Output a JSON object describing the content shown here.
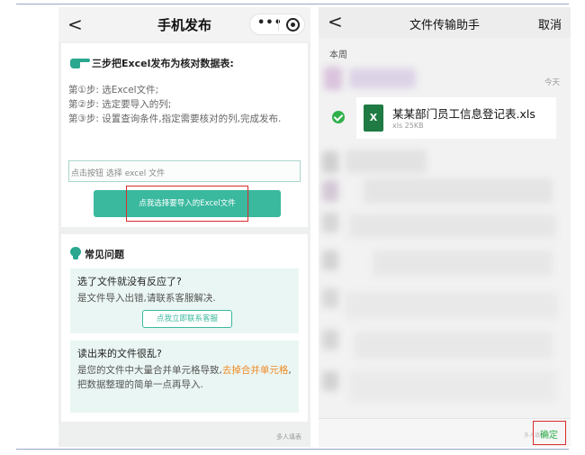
{
  "left": {
    "nav": {
      "back": "<",
      "title": "手机发布",
      "capsule_dots": "•••"
    },
    "card1": {
      "heading": "三步把Excel发布为核对数据表:",
      "steps": [
        "第①步: 选Excel文件;",
        "第②步: 选定要导入的列;",
        "第③步: 设置查询条件,指定需要核对的列,完成发布."
      ],
      "file_input_placeholder": "点击按钮 选择 excel 文件",
      "primary_button": "点我选择要导入的Excel文件"
    },
    "faq": {
      "title": "常见问题",
      "items": [
        {
          "q": "选了文件就没有反应了?",
          "a": "是文件导入出错,请联系客服解决.",
          "button": "点我立即联系客服"
        },
        {
          "q": "读出来的文件很乱?",
          "a_pre": "是您的文件中大量合并单元格导致,",
          "a_highlight": "去掉合并单元格",
          "a_post": ",把数据整理的简单一点再导入."
        }
      ]
    },
    "watermark": "多人填表"
  },
  "right": {
    "nav": {
      "back": "<",
      "title": "文件传输助手",
      "cancel": "取消"
    },
    "section_label": "本周",
    "today": "今天",
    "file": {
      "icon_letter": "X",
      "name": "某某部门员工信息登记表.xls",
      "meta": "xls 25KB"
    },
    "confirm": "确定",
    "watermark": "多人填表"
  },
  "colors": {
    "accent_teal": "#3ab99f",
    "highlight_red": "#d92b2b",
    "wechat_green": "#2fb04a",
    "excel_green": "#1f7a43",
    "orange": "#f08a24"
  }
}
